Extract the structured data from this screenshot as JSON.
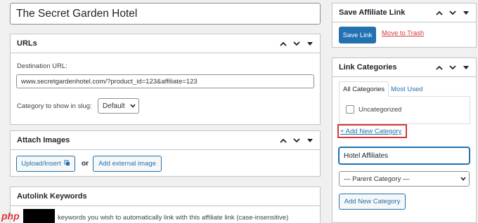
{
  "post": {
    "title": "The Secret Garden Hotel"
  },
  "urls_box": {
    "title": "URLs",
    "destination_label": "Destination URL:",
    "destination_value": "www.secretgardenhotel.com/?product_id=123&affiliate=123",
    "slug_label": "Category to show in slug:",
    "slug_selected": "Default"
  },
  "attach_box": {
    "title": "Attach Images",
    "upload_label": "Upload/Insert",
    "or_text": "or",
    "external_label": "Add external image"
  },
  "autolink_box": {
    "title": "Autolink Keywords",
    "description": "keywords you wish to automatically link with this affiliate link (case-insensitive)"
  },
  "save_box": {
    "title": "Save Affiliate Link",
    "save_label": "Save Link",
    "trash_label": "Move to Trash"
  },
  "categories_box": {
    "title": "Link Categories",
    "tabs": [
      "All Categories",
      "Most Used"
    ],
    "items": [
      "Uncategorized"
    ],
    "add_new_link": "+ Add New Category",
    "new_category_value": "Hotel Affiliates",
    "parent_selected": "— Parent Category —",
    "add_button_label": "Add New Category"
  },
  "watermark": {
    "text": "php"
  },
  "colors": {
    "accent": "#2271b1",
    "danger": "#d63638",
    "highlight": "#d63638"
  },
  "icons": [
    "chevron-up-icon",
    "chevron-down-icon",
    "caret-down-icon",
    "media-icon",
    "select-chevron-icon"
  ]
}
